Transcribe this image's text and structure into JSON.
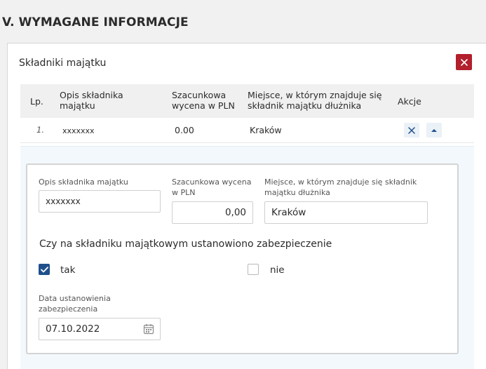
{
  "section_title": "V. WYMAGANE INFORMACJE",
  "card": {
    "title": "Składniki majątku",
    "close_icon": "close-icon"
  },
  "table": {
    "headers": {
      "lp": "Lp.",
      "opis": [
        "Opis składnika",
        "majątku"
      ],
      "wycena": [
        "Szacunkowa",
        "wycena w PLN"
      ],
      "miejsce": [
        "Miejsce, w którym znajduje się",
        "składnik majątku dłużnika"
      ],
      "akcje": "Akcje"
    },
    "rows": [
      {
        "lp": "1.",
        "opis": "xxxxxxx",
        "wycena": "0.00",
        "miejsce": "Kraków"
      }
    ],
    "action_icons": [
      "close-icon",
      "chevron-up-icon"
    ]
  },
  "form": {
    "opis_label": "Opis składnika majątku",
    "opis_value": "xxxxxxx",
    "wycena_label": [
      "Szacunkowa wycena",
      "w PLN"
    ],
    "wycena_value": "0,00",
    "miejsce_label": [
      "Miejsce, w którym znajduje się składnik",
      "majątku dłużnika"
    ],
    "miejsce_value": "Kraków",
    "question": "Czy na składniku majątkowym ustanowiono zabezpieczenie",
    "option_tak": "tak",
    "option_nie": "nie",
    "tak_checked": true,
    "nie_checked": false,
    "data_label": [
      "Data ustanowienia",
      "zabezpieczenia"
    ],
    "data_value": "07.10.2022",
    "calendar_icon": "calendar-icon"
  },
  "colors": {
    "close_button": "#b21f2d",
    "checkbox_checked": "#1f4f8b",
    "action_icon": "#1f4f8b",
    "expand_bg": "#f3f8fd"
  }
}
